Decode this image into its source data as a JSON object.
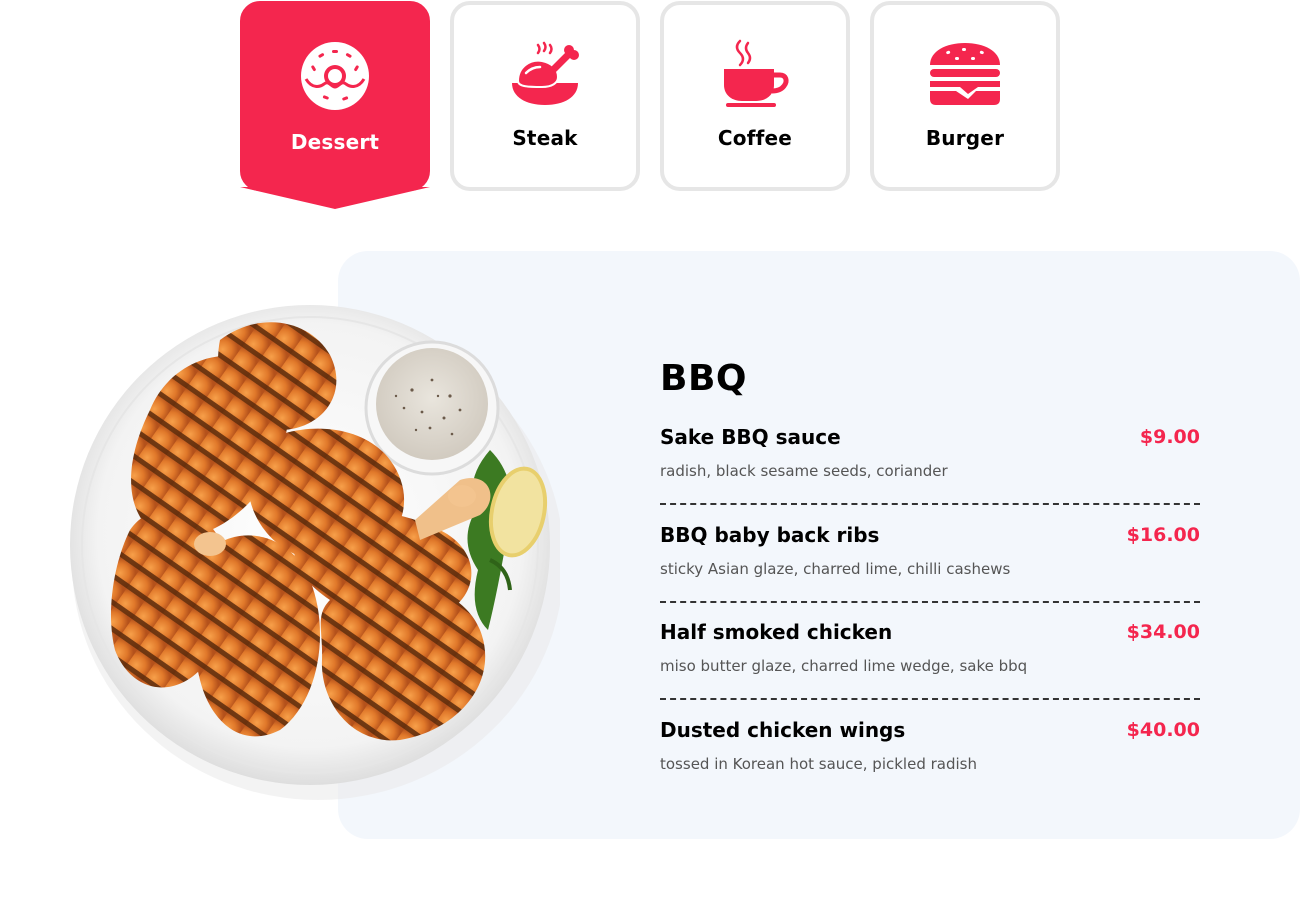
{
  "tabs": [
    {
      "label": "Dessert",
      "icon": "donut-icon",
      "active": true
    },
    {
      "label": "Steak",
      "icon": "chicken-leg-icon",
      "active": false
    },
    {
      "label": "Coffee",
      "icon": "coffee-cup-icon",
      "active": false
    },
    {
      "label": "Burger",
      "icon": "burger-icon",
      "active": false
    }
  ],
  "menu": {
    "title": "BBQ",
    "items": [
      {
        "name": "Sake BBQ sauce",
        "price": "$9.00",
        "description": "radish, black sesame seeds, coriander"
      },
      {
        "name": "BBQ baby back ribs",
        "price": "$16.00",
        "description": "sticky Asian glaze, charred lime, chilli cashews"
      },
      {
        "name": "Half smoked chicken",
        "price": "$34.00",
        "description": "miso butter glaze, charred lime wedge, sake bbq"
      },
      {
        "name": "Dusted chicken wings",
        "price": "$40.00",
        "description": "tossed in Korean hot sauce, pickled radish"
      }
    ]
  },
  "image": {
    "subject": "grilled-chicken-plate"
  },
  "colors": {
    "accent": "#f4264e",
    "panel_background": "#f3f7fc",
    "tab_border": "#e6e6e6",
    "text": "#000000",
    "muted_text": "#555555"
  }
}
